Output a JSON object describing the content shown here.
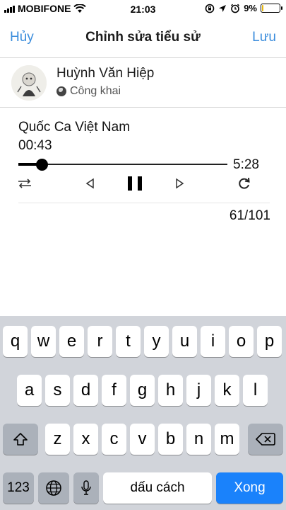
{
  "status_bar": {
    "carrier": "MOBIFONE",
    "time": "21:03",
    "battery_percent": "9%",
    "battery_level": 0.09,
    "battery_color": "#e8b80c",
    "icons": [
      "signal-icon",
      "wifi-icon",
      "rotation-lock-icon",
      "location-icon",
      "alarm-icon",
      "battery-icon"
    ]
  },
  "nav": {
    "cancel_label": "Hủy",
    "title": "Chỉnh sửa tiểu sử",
    "save_label": "Lưu",
    "accent_color": "#3b8ddc"
  },
  "profile": {
    "name": "Huỳnh Văn Hiệp",
    "privacy": "Công khai"
  },
  "player": {
    "song_title": "Quốc Ca Việt Nam",
    "current_time": "00:43",
    "duration": "5:28",
    "progress_fraction": 0.11,
    "counter": "61/101",
    "icons": [
      "shuffle-icon",
      "previous-icon",
      "pause-icon",
      "next-icon",
      "repeat-icon"
    ]
  },
  "keyboard": {
    "row1": [
      "q",
      "w",
      "e",
      "r",
      "t",
      "y",
      "u",
      "i",
      "o",
      "p"
    ],
    "row2": [
      "a",
      "s",
      "d",
      "f",
      "g",
      "h",
      "j",
      "k",
      "l"
    ],
    "row3": [
      "z",
      "x",
      "c",
      "v",
      "b",
      "n",
      "m"
    ],
    "numbers_label": "123",
    "space_label": "dấu cách",
    "done_label": "Xong",
    "done_color": "#1a82fb"
  }
}
